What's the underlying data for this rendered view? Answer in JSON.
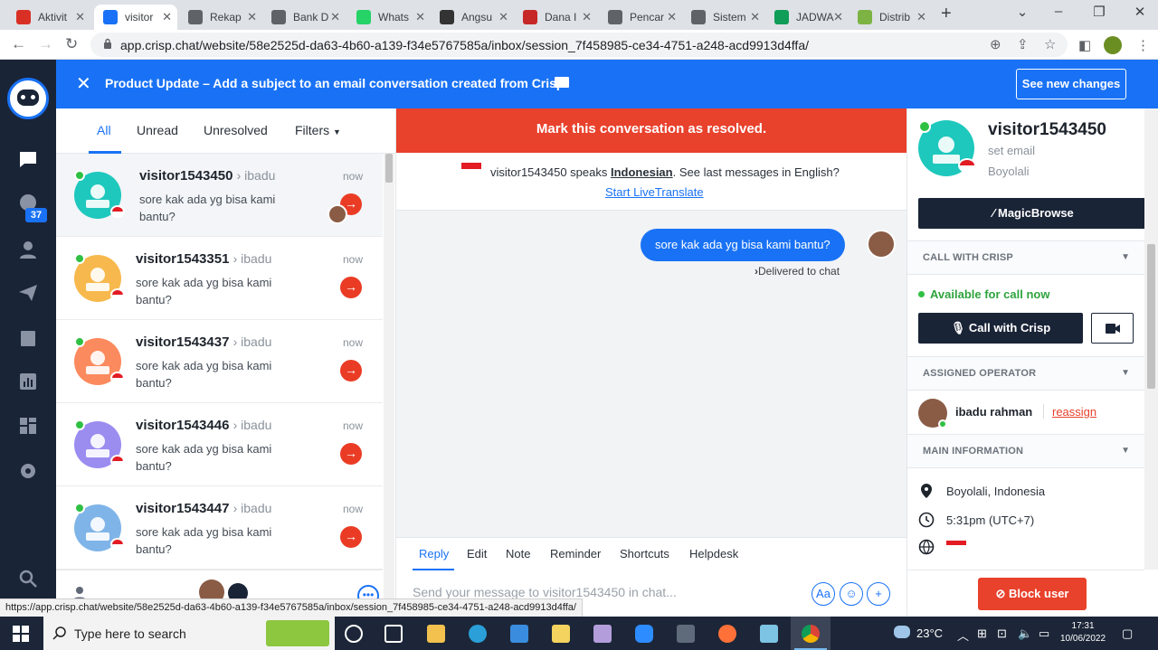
{
  "browser": {
    "tabs": [
      {
        "title": "Aktivit",
        "color": "#d93025"
      },
      {
        "title": "visitor",
        "color": "#1972f5",
        "active": true
      },
      {
        "title": "Rekap",
        "color": "#5f6368"
      },
      {
        "title": "Bank D",
        "color": "#5f6368"
      },
      {
        "title": "Whats",
        "color": "#25d366"
      },
      {
        "title": "Angsu",
        "color": "#333"
      },
      {
        "title": "Dana I",
        "color": "#c62828"
      },
      {
        "title": "Pencar",
        "color": "#5f6368"
      },
      {
        "title": "Sistem",
        "color": "#5f6368"
      },
      {
        "title": "JADWA",
        "color": "#0f9d58"
      },
      {
        "title": "Distrib",
        "color": "#7cb342"
      }
    ],
    "url": "app.crisp.chat/website/58e2525d-da63-4b60-a139-f34e5767585a/inbox/session_7f458985-ce34-4751-a248-acd9913d4ffa/",
    "status_url": "https://app.crisp.chat/website/58e2525d-da63-4b60-a139-f34e5767585a/inbox/session_7f458985-ce34-4751-a248-acd9913d4ffa/"
  },
  "sidebar": {
    "badge": "37"
  },
  "banner": {
    "text": "Product Update – Add a subject to an email conversation created from Crisp",
    "button": "See new changes"
  },
  "filters": {
    "all": "All",
    "unread": "Unread",
    "unresolved": "Unresolved",
    "filters": "Filters"
  },
  "conversations": [
    {
      "name": "visitor1543450",
      "operator": "ibadu",
      "message": "sore kak ada yg bisa kami bantu?",
      "time": "now",
      "color": "#1ec8bd"
    },
    {
      "name": "visitor1543351",
      "operator": "ibadu",
      "message": "sore kak ada yg bisa kami bantu?",
      "time": "now",
      "color": "#f7b94d"
    },
    {
      "name": "visitor1543437",
      "operator": "ibadu",
      "message": "sore kak ada yg bisa kami bantu?",
      "time": "now",
      "color": "#fb8a5e"
    },
    {
      "name": "visitor1543446",
      "operator": "ibadu",
      "message": "sore kak ada yg bisa kami bantu?",
      "time": "now",
      "color": "#9b8cf0"
    },
    {
      "name": "visitor1543447",
      "operator": "ibadu",
      "message": "sore kak ada yg bisa kami bantu?",
      "time": "now",
      "color": "#7fb4e8"
    }
  ],
  "chat": {
    "resolve": "Mark this conversation as resolved.",
    "translate_prefix": "visitor1543450 speaks ",
    "translate_lang": "Indonesian",
    "translate_suffix": ". See last messages in English?",
    "translate_link": "Start LiveTranslate",
    "message": "sore kak ada yg bisa kami bantu?",
    "delivered": "Delivered to chat",
    "composer_tabs": {
      "reply": "Reply",
      "edit": "Edit",
      "note": "Note",
      "reminder": "Reminder",
      "shortcuts": "Shortcuts",
      "helpdesk": "Helpdesk"
    },
    "placeholder": "Send your message to visitor1543450 in chat..."
  },
  "profile": {
    "name": "visitor1543450",
    "email": "set email",
    "city": "Boyolali",
    "magic": "MagicBrowse",
    "call_section": "CALL WITH CRISP",
    "available": "Available for call now",
    "call_button": "Call with Crisp",
    "operator_section": "ASSIGNED OPERATOR",
    "operator_name": "ibadu rahman",
    "reassign": "reassign",
    "main_section": "MAIN INFORMATION",
    "location": "Boyolali, Indonesia",
    "local_time": "5:31pm (UTC+7)",
    "block": "Block user"
  },
  "taskbar": {
    "search": "Type here to search",
    "temp": "23°C",
    "time": "17:31",
    "date": "10/06/2022"
  },
  "colors": {
    "brand": "#1972f5",
    "danger": "#e8412c",
    "dark": "#1a2437",
    "online": "#2fc043"
  }
}
